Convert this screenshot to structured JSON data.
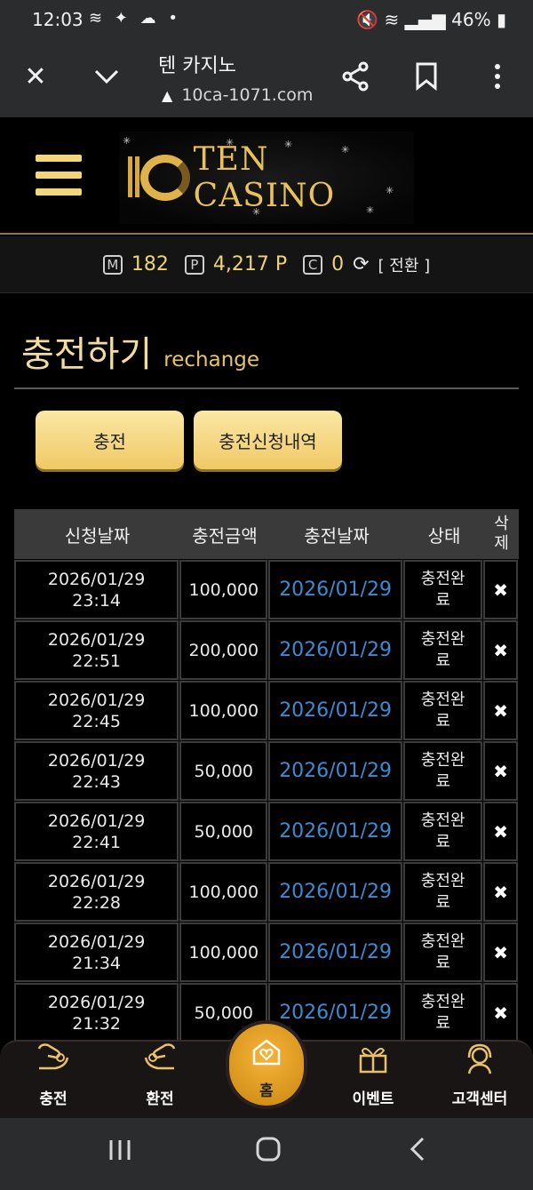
{
  "status_bar": {
    "time": "12:03",
    "notification_icons": "≋ ✦ ☁ •",
    "right": "46%"
  },
  "browser": {
    "title": "텐 카지노",
    "url": "10ca-1071.com"
  },
  "header": {
    "logo_text": "TEN CASINO"
  },
  "points": {
    "m_label": "M",
    "m_value": "182",
    "p_label": "P",
    "p_value": "4,217 P",
    "c_label": "C",
    "c_value": "0",
    "convert_label": "[ 전환 ]"
  },
  "page": {
    "title": "충전하기",
    "subtitle": "rechange"
  },
  "tabs": {
    "charge": "충전",
    "history": "충전신청내역"
  },
  "table": {
    "headers": [
      "신청날짜",
      "충전금액",
      "충전날짜",
      "상태",
      "삭제"
    ],
    "rows": [
      {
        "date": "2026/01/29",
        "time": "23:14",
        "amount": "100,000",
        "charged": "2026/01/29",
        "status": "충전완료",
        "delete": "✖"
      },
      {
        "date": "2026/01/29",
        "time": "22:51",
        "amount": "200,000",
        "charged": "2026/01/29",
        "status": "충전완료",
        "delete": "✖"
      },
      {
        "date": "2026/01/29",
        "time": "22:45",
        "amount": "100,000",
        "charged": "2026/01/29",
        "status": "충전완료",
        "delete": "✖"
      },
      {
        "date": "2026/01/29",
        "time": "22:43",
        "amount": "50,000",
        "charged": "2026/01/29",
        "status": "충전완료",
        "delete": "✖"
      },
      {
        "date": "2026/01/29",
        "time": "22:41",
        "amount": "50,000",
        "charged": "2026/01/29",
        "status": "충전완료",
        "delete": "✖"
      },
      {
        "date": "2026/01/29",
        "time": "22:28",
        "amount": "100,000",
        "charged": "2026/01/29",
        "status": "충전완료",
        "delete": "✖"
      },
      {
        "date": "2026/01/29",
        "time": "21:34",
        "amount": "100,000",
        "charged": "2026/01/29",
        "status": "충전완료",
        "delete": "✖"
      },
      {
        "date": "2026/01/29",
        "time": "21:32",
        "amount": "50,000",
        "charged": "2026/01/29",
        "status": "충전완료",
        "delete": "✖"
      }
    ]
  },
  "bottom_nav": {
    "charge": "충전",
    "exchange": "환전",
    "home": "홈",
    "event": "이벤트",
    "support": "고객센터"
  },
  "colors": {
    "gold": "#f0c966",
    "link_blue": "#3e8ad0",
    "home_orange": "#f6b43b"
  }
}
